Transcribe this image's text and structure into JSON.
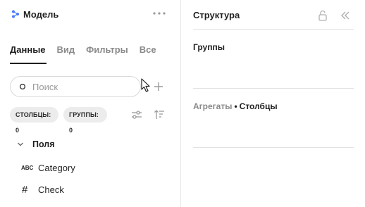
{
  "left_panel": {
    "title": "Модель",
    "tabs": [
      {
        "label": "Данные",
        "active": true
      },
      {
        "label": "Вид",
        "active": false
      },
      {
        "label": "Фильтры",
        "active": false
      },
      {
        "label": "Все",
        "active": false
      }
    ],
    "search": {
      "placeholder": "Поиск",
      "value": ""
    },
    "chips": {
      "columns": "СТОЛБЦЫ: 0",
      "groups": "ГРУППЫ: 0"
    },
    "fields_section": {
      "label": "Поля",
      "expanded": true,
      "items": [
        {
          "type_icon": "ABC",
          "label": "Category"
        },
        {
          "type_icon": "#",
          "label": "Check"
        }
      ]
    },
    "icons": {
      "logo": "model-icon",
      "more": "more-dots-icon",
      "add": "plus-icon",
      "settings": "sliders-icon",
      "sort": "sort-icon"
    }
  },
  "right_panel": {
    "title": "Структура",
    "groups_title": "Группы",
    "aggregates_label": "Агрегаты",
    "separator": "•",
    "columns_label": "Столбцы",
    "icons": {
      "lock": "lock-icon",
      "collapse": "double-chevron-left-icon"
    }
  },
  "colors": {
    "accent": "#4a7cf7",
    "text": "#1f1f1f",
    "muted": "#8a8a8a",
    "chip_bg": "#ececec",
    "border": "#e2e2e2"
  }
}
